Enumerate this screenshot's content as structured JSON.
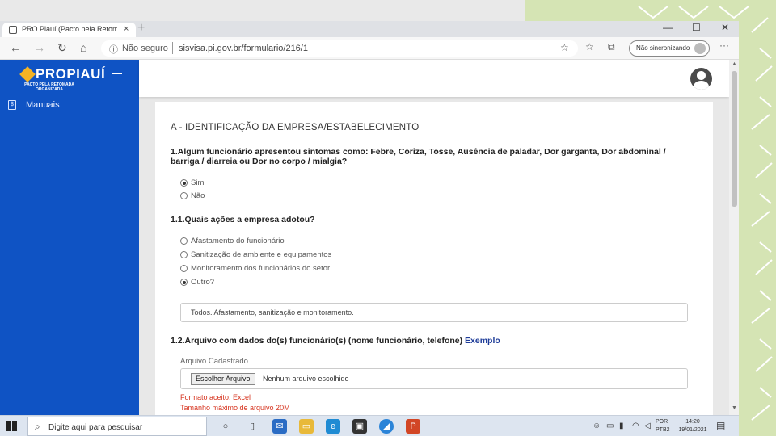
{
  "colors": {
    "sidebar": "#0f53c4",
    "accent_yellow": "#f3b324",
    "hint_red": "#d6341f",
    "slide_green": "#d5e4b4",
    "link_blue": "#1e3c99"
  },
  "browser": {
    "tab_title": "PRO Piauí (Pacto pela Retomada",
    "tab_close": "×",
    "new_tab": "+",
    "win_minimize": "—",
    "win_maximize": "☐",
    "win_close": "✕",
    "address": {
      "security_label": "Não seguro",
      "url": "sisvisa.pi.gov.br/formulario/216/1"
    },
    "sync_label": "Não sincronizando",
    "icons": [
      "back-arrow-icon",
      "forward-arrow-icon",
      "refresh-icon",
      "home-icon",
      "info-icon",
      "star-icon",
      "favorites-icon",
      "collections-icon",
      "more-icon"
    ]
  },
  "app": {
    "logo": "PROPIAUÍ",
    "logo_sub": "PACTO PELA RETOMADA ORGANIZADA",
    "sidebar_items": [
      {
        "label": "Manuais",
        "icon": "document-icon"
      }
    ]
  },
  "form": {
    "section_title": "A - IDENTIFICAÇÃO DA EMPRESA/ESTABELECIMENTO",
    "q1": {
      "text": "1.Algum funcionário apresentou sintomas como: Febre, Coriza, Tosse, Ausência de paladar, Dor garganta, Dor abdominal / barriga / diarreia ou Dor no corpo / mialgia?",
      "options": [
        {
          "label": "Sim",
          "checked": true
        },
        {
          "label": "Não",
          "checked": false
        }
      ]
    },
    "q11": {
      "text": "1.1.Quais ações a empresa adotou?",
      "options": [
        {
          "label": "Afastamento do funcionário",
          "checked": false
        },
        {
          "label": "Sanitização de ambiente e equipamentos",
          "checked": false
        },
        {
          "label": "Monitoramento dos funcionários do setor",
          "checked": false
        },
        {
          "label": "Outro?",
          "checked": true
        }
      ],
      "other_value": "Todos. Afastamento, sanitização e monitoramento."
    },
    "q12": {
      "text": "1.2.Arquivo com dados do(s) funcionário(s) (nome funcionário, telefone)",
      "link": "Exemplo",
      "file_label": "Arquivo Cadastrado",
      "file_button": "Escolher Arquivo",
      "file_status": "Nenhum arquivo escolhido",
      "hint_format": "Formato aceito: Excel",
      "hint_size": "Tamanho máximo de arquivo 20M"
    }
  },
  "taskbar": {
    "search_placeholder": "Digite aqui para pesquisar",
    "lang_line1": "POR",
    "lang_line2": "PTB2",
    "time": "14:20",
    "date": "19/01/2021"
  }
}
